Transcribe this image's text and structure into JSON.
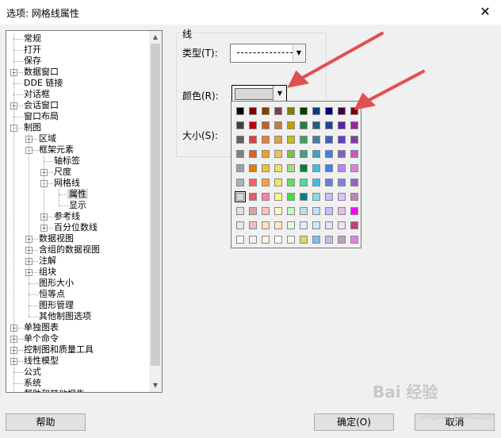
{
  "window": {
    "title": "选项: 网格线属性",
    "close_glyph": "✕"
  },
  "tree": {
    "items": [
      {
        "label": "常规",
        "level": 0,
        "expander": ""
      },
      {
        "label": "打开",
        "level": 0,
        "expander": ""
      },
      {
        "label": "保存",
        "level": 0,
        "expander": ""
      },
      {
        "label": "数据窗口",
        "level": 0,
        "expander": "+"
      },
      {
        "label": "DDE 链接",
        "level": 0,
        "expander": ""
      },
      {
        "label": "对话框",
        "level": 0,
        "expander": ""
      },
      {
        "label": "会话窗口",
        "level": 0,
        "expander": "+"
      },
      {
        "label": "窗口布局",
        "level": 0,
        "expander": ""
      },
      {
        "label": "制图",
        "level": 0,
        "expander": "-"
      },
      {
        "label": "区域",
        "level": 1,
        "expander": "+"
      },
      {
        "label": "框架元素",
        "level": 1,
        "expander": "-"
      },
      {
        "label": "轴标签",
        "level": 2,
        "expander": ""
      },
      {
        "label": "尺度",
        "level": 2,
        "expander": "+"
      },
      {
        "label": "网格线",
        "level": 2,
        "expander": "-"
      },
      {
        "label": "属性",
        "level": 3,
        "expander": "",
        "selected": true
      },
      {
        "label": "显示",
        "level": 3,
        "expander": ""
      },
      {
        "label": "参考线",
        "level": 2,
        "expander": "+"
      },
      {
        "label": "百分位数线",
        "level": 2,
        "expander": "+"
      },
      {
        "label": "数据视图",
        "level": 1,
        "expander": "+"
      },
      {
        "label": "含组的数据视图",
        "level": 1,
        "expander": "+"
      },
      {
        "label": "注解",
        "level": 1,
        "expander": "+"
      },
      {
        "label": "组块",
        "level": 1,
        "expander": "+"
      },
      {
        "label": "图形大小",
        "level": 1,
        "expander": ""
      },
      {
        "label": "恒等点",
        "level": 1,
        "expander": ""
      },
      {
        "label": "图形管理",
        "level": 1,
        "expander": ""
      },
      {
        "label": "其他制图选项",
        "level": 1,
        "expander": ""
      },
      {
        "label": "单独图表",
        "level": 0,
        "expander": "+"
      },
      {
        "label": "单个命令",
        "level": 0,
        "expander": "+"
      },
      {
        "label": "控制图和质量工具",
        "level": 0,
        "expander": "+"
      },
      {
        "label": "线性模型",
        "level": 0,
        "expander": "+"
      },
      {
        "label": "公式",
        "level": 0,
        "expander": ""
      },
      {
        "label": "系统",
        "level": 0,
        "expander": ""
      },
      {
        "label": "帮助和其他报告",
        "level": 0,
        "expander": ""
      }
    ],
    "scroll_up": "▲",
    "scroll_down": "▼"
  },
  "line_group": {
    "label": "线",
    "type_label": "类型(T):",
    "color_label": "颜色(R):",
    "size_label": "大小(S):",
    "type_value": "dashed",
    "color_value": "#d8d8d8",
    "combo_arrow": "▼"
  },
  "palette": {
    "rows": [
      [
        "#000000",
        "#800000",
        "#804000",
        "#804040",
        "#808000",
        "#004000",
        "#004080",
        "#000080",
        "#400040",
        "#800000"
      ],
      [
        "#404040",
        "#c00000",
        "#c06030",
        "#c08040",
        "#c0a000",
        "#208040",
        "#206080",
        "#2040a0",
        "#6020a0",
        "#a020a0"
      ],
      [
        "#606060",
        "#e04040",
        "#e08040",
        "#e0a040",
        "#c0c020",
        "#40a060",
        "#4080a0",
        "#4060c0",
        "#6040c0",
        "#8040a0"
      ],
      [
        "#808080",
        "#e06020",
        "#f0a020",
        "#f0c060",
        "#80c040",
        "#40a080",
        "#40a0c0",
        "#4080e0",
        "#8060c0",
        "#c060c0"
      ],
      [
        "#a0a0a0",
        "#e08000",
        "#f0c040",
        "#f0e060",
        "#a0e080",
        "#008040",
        "#40c0e0",
        "#4080ff",
        "#c080ff",
        "#e080e0"
      ],
      [
        "#b0b0b0",
        "#ff6060",
        "#ffa040",
        "#ffe060",
        "#60e060",
        "#40e0a0",
        "#40c0e0",
        "#6080e0",
        "#8080e0",
        "#a060c0"
      ],
      [
        "#d8d8d8",
        "#e06060",
        "#ff80a0",
        "#ffff80",
        "#40e040",
        "#008080",
        "#80e0e0",
        "#c0c0ff",
        "#e0c0ff",
        "#c080c0"
      ],
      [
        "#e0e0e0",
        "#e0a0a0",
        "#ffc0c0",
        "#ffffc0",
        "#c0ffc0",
        "#c0e0e0",
        "#c0e0ff",
        "#c0c0ff",
        "#e0c0e0",
        "#ff00ff"
      ],
      [
        "#e8e8e8",
        "#f0c0c0",
        "#ffe0c0",
        "#ffe8c0",
        "#e0ffe0",
        "#e0f0f0",
        "#d0e8ff",
        "#e0e0ff",
        "#f0e0f0",
        "#c04080"
      ],
      [
        "#f8f8f8",
        "#f8f0f0",
        "#fff0e0",
        "#fffff0",
        "#f0fff0",
        "#d0e060",
        "#80c0e0",
        "#c0c0e0",
        "#c0a0c0",
        "#e080e0"
      ]
    ]
  },
  "buttons": {
    "help": "帮助",
    "ok": "确定(O)",
    "cancel": "取消"
  },
  "watermark": {
    "main": "Bai 经验",
    "sub": "jingyan.baidu.com"
  },
  "colors": {
    "arrow": "#e05050"
  }
}
